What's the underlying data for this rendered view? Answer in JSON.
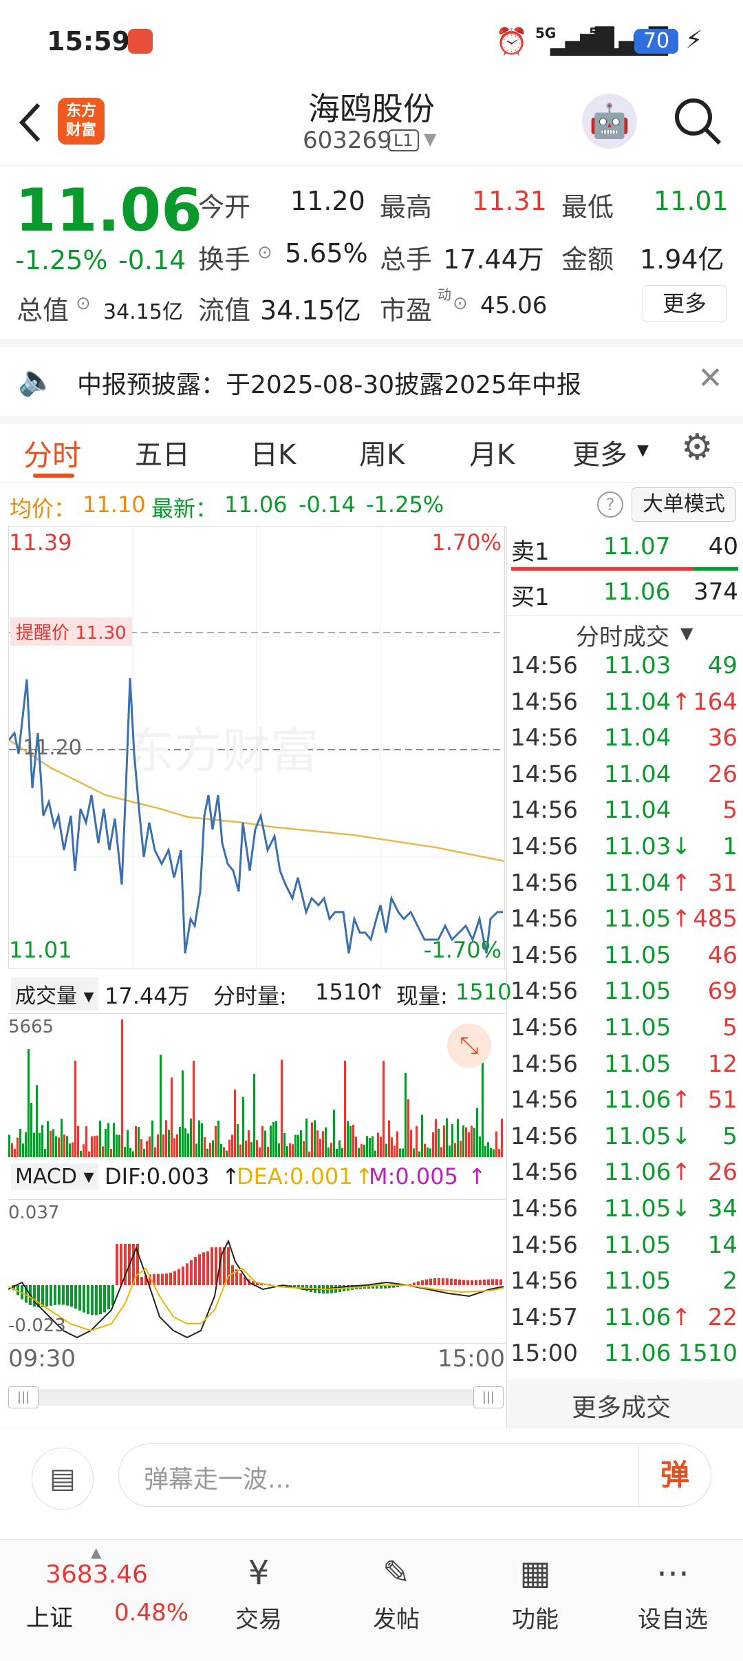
{
  "status_bar": {
    "time": "15:59",
    "signal1": "5G",
    "signal2": "5G",
    "battery": "70"
  },
  "header": {
    "back_icon": "back-arrow-icon",
    "logo_text": "东方\n财富",
    "stock_name": "海鸥股份",
    "stock_code": "603269",
    "level": "L1"
  },
  "quote": {
    "price": "11.06",
    "change_pct": "-1.25%",
    "change_abs": "-0.14",
    "open_label": "今开",
    "open": "11.20",
    "high_label": "最高",
    "high": "11.31",
    "low_label": "最低",
    "low": "11.01",
    "turnover_label": "换手",
    "turnover": "5.65%",
    "volume_label": "总手",
    "volume": "17.44万",
    "amount_label": "金额",
    "amount": "1.94亿",
    "mktcap_label": "总值",
    "mktcap": "34.15亿",
    "float_label": "流值",
    "float": "34.15亿",
    "pe_label": "市盈",
    "pe_sup": "动",
    "pe": "45.06",
    "more_button": "更多"
  },
  "notice": {
    "text": "中报预披露：于2025-08-30披露2025年中报"
  },
  "tabs": [
    "分时",
    "五日",
    "日K",
    "周K",
    "月K",
    "更多"
  ],
  "chart_header": {
    "avg_label": "均价：",
    "avg": "11.10",
    "latest_label": "最新：",
    "latest": "11.06",
    "chg": "-0.14",
    "chg_pct": "-1.25%",
    "mode_button": "大单模式"
  },
  "price_chart": {
    "top_price": "11.39",
    "top_pct": "1.70%",
    "bottom_price": "11.01",
    "bottom_pct": "-1.70%",
    "alert_label": "提醒价 11.30",
    "ref_label": "11.20",
    "watermark": "东方财富"
  },
  "volume_header": {
    "label": "成交量",
    "total": "17.44万",
    "minute_label": "分时量:",
    "minute_val": "1510",
    "now_label": "现量:",
    "now_val": "1510",
    "max": "5665"
  },
  "macd_header": {
    "label": "MACD",
    "dif": "DIF:0.003",
    "dea": "DEA:0.001",
    "m": "M:0.005",
    "top": "0.037",
    "bottom": "-0.023"
  },
  "time_axis": {
    "start": "09:30",
    "end": "15:00"
  },
  "order_book": {
    "sell1_label": "卖1",
    "sell1_price": "11.07",
    "sell1_vol": "40",
    "buy1_label": "买1",
    "buy1_price": "11.06",
    "buy1_vol": "374",
    "trades_header": "分时成交"
  },
  "trades": [
    {
      "time": "14:56",
      "price": "11.03",
      "arrow": "",
      "vol": "49",
      "color": "green"
    },
    {
      "time": "14:56",
      "price": "11.04",
      "arrow": "↑",
      "vol": "164",
      "color": "red"
    },
    {
      "time": "14:56",
      "price": "11.04",
      "arrow": "",
      "vol": "36",
      "color": "red"
    },
    {
      "time": "14:56",
      "price": "11.04",
      "arrow": "",
      "vol": "26",
      "color": "red"
    },
    {
      "time": "14:56",
      "price": "11.04",
      "arrow": "",
      "vol": "5",
      "color": "red"
    },
    {
      "time": "14:56",
      "price": "11.03",
      "arrow": "↓",
      "vol": "1",
      "color": "green"
    },
    {
      "time": "14:56",
      "price": "11.04",
      "arrow": "↑",
      "vol": "31",
      "color": "red"
    },
    {
      "time": "14:56",
      "price": "11.05",
      "arrow": "↑",
      "vol": "485",
      "color": "red"
    },
    {
      "time": "14:56",
      "price": "11.05",
      "arrow": "",
      "vol": "46",
      "color": "red"
    },
    {
      "time": "14:56",
      "price": "11.05",
      "arrow": "",
      "vol": "69",
      "color": "red"
    },
    {
      "time": "14:56",
      "price": "11.05",
      "arrow": "",
      "vol": "5",
      "color": "red"
    },
    {
      "time": "14:56",
      "price": "11.05",
      "arrow": "",
      "vol": "12",
      "color": "red"
    },
    {
      "time": "14:56",
      "price": "11.06",
      "arrow": "↑",
      "vol": "51",
      "color": "red"
    },
    {
      "time": "14:56",
      "price": "11.05",
      "arrow": "↓",
      "vol": "5",
      "color": "green"
    },
    {
      "time": "14:56",
      "price": "11.06",
      "arrow": "↑",
      "vol": "26",
      "color": "red"
    },
    {
      "time": "14:56",
      "price": "11.05",
      "arrow": "↓",
      "vol": "34",
      "color": "green"
    },
    {
      "time": "14:56",
      "price": "11.05",
      "arrow": "",
      "vol": "14",
      "color": "green"
    },
    {
      "time": "14:56",
      "price": "11.05",
      "arrow": "",
      "vol": "2",
      "color": "green"
    },
    {
      "time": "14:57",
      "price": "11.06",
      "arrow": "↑",
      "vol": "22",
      "color": "red"
    },
    {
      "time": "15:00",
      "price": "11.06",
      "arrow": "",
      "vol": "1510",
      "color": "green"
    }
  ],
  "more_trades": "更多成交",
  "comment_bar": {
    "placeholder": "弹幕走一波...",
    "send_label": "弹"
  },
  "bottom_nav": {
    "index_value": "3683.46",
    "index_name": "上证",
    "index_pct": "0.48%",
    "items": [
      "交易",
      "发帖",
      "功能",
      "设自选"
    ]
  },
  "colors": {
    "up": "#e53935",
    "down": "#0a9a2c",
    "accent": "#f08a00",
    "price_line": "#3a6fb0",
    "avg_line": "#e8b84a"
  }
}
